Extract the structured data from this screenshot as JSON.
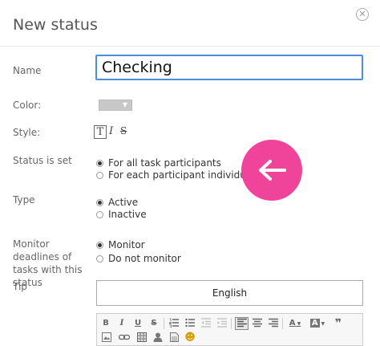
{
  "dialog": {
    "title": "New status",
    "close_glyph": "✕"
  },
  "form": {
    "name_label": "Name",
    "name_value": "Checking",
    "color_label": "Color:",
    "color_value": "#c8c8c8",
    "style_label": "Style:",
    "style_options": [
      "T",
      "I",
      "S"
    ],
    "status_label": "Status is set",
    "status_options": [
      {
        "label": "For all task participants",
        "checked": true
      },
      {
        "label": "For each participant individually",
        "checked": false
      }
    ],
    "type_label": "Type",
    "type_options": [
      {
        "label": "Active",
        "checked": true
      },
      {
        "label": "Inactive",
        "checked": false
      }
    ],
    "monitor_label": "Monitor deadlines of tasks with this status",
    "monitor_options": [
      {
        "label": "Monitor",
        "checked": true
      },
      {
        "label": "Do not monitor",
        "checked": false
      }
    ],
    "tip_label": "Tip",
    "language_button": "English"
  },
  "colors": {
    "accent_input_border": "#4a90d9",
    "pink_button": "#f0439a"
  },
  "toolbar": {
    "row1": [
      "bold-icon",
      "italic-icon",
      "underline-icon",
      "strike-icon",
      "ordered-list-icon",
      "unordered-list-icon",
      "outdent-icon",
      "indent-icon",
      "align-left-icon",
      "align-center-icon",
      "align-right-icon",
      "text-color-icon",
      "bg-color-icon",
      "quote-icon"
    ],
    "row2": [
      "image-icon",
      "link-icon",
      "table-icon",
      "user-icon",
      "file-icon",
      "smiley-icon"
    ],
    "glyphs": {
      "bold": "B",
      "italic": "I",
      "underline": "U",
      "strike": "S",
      "text_color": "A",
      "bg_color": "A",
      "quote": "❞",
      "smiley": "☻"
    }
  }
}
